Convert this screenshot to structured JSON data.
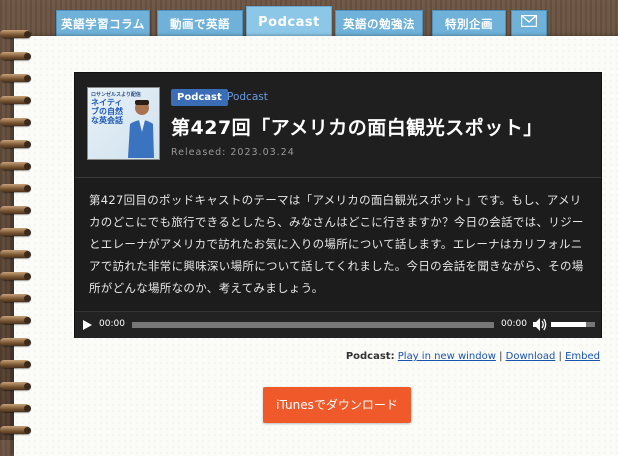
{
  "nav": {
    "tabs": [
      {
        "label": "英語学習コラム"
      },
      {
        "label": "動画で英語"
      },
      {
        "label": "Podcast"
      },
      {
        "label": "英語の勉強法"
      },
      {
        "label": "特別企画"
      }
    ],
    "mail_icon": "mail-icon"
  },
  "episode": {
    "thumbnail": {
      "tagline": "ロサンゼルスより配信",
      "title": "ネイティブの自然な英会話"
    },
    "badge": "Podcast",
    "category": "Podcast",
    "title": "第427回「アメリカの面白観光スポット」",
    "released": "Released: 2023.03.24",
    "description": "第427回目のポッドキャストのテーマは「アメリカの面白観光スポット」です。もし、アメリカのどこにでも旅行できるとしたら、みなさんはどこに行きますか？今日の会話では、リジーとエレーナがアメリカで訪れたお気に入りの場所について話します。エレーナはカリフォルニアで訪れた非常に興味深い場所について話してくれました。今日の会話を聞きながら、その場所がどんな場所なのか、考えてみましょう。"
  },
  "player": {
    "current_time": "00:00",
    "duration": "00:00",
    "progress": 0,
    "volume": 0.8
  },
  "links": {
    "label": "Podcast:",
    "play_new_window": "Play in new window",
    "sep1": " | ",
    "download": "Download",
    "sep2": " | ",
    "embed": "Embed"
  },
  "itunes_button": "iTunesでダウンロード",
  "colors": {
    "tab": "#6fb1d9",
    "badge": "#3a6db5",
    "itunes": "#f05a2a",
    "link": "#1a55b0"
  }
}
